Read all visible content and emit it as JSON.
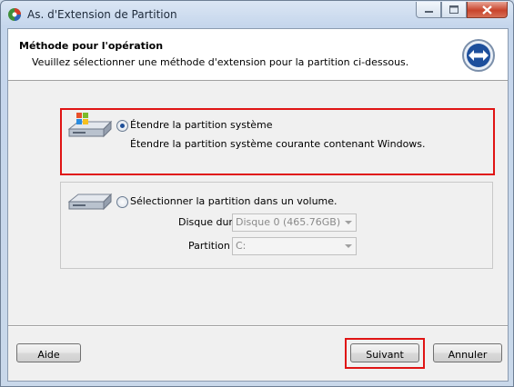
{
  "window": {
    "title": "As. d'Extension de Partition",
    "controls": [
      "minimize-icon",
      "maximize-icon",
      "close-icon"
    ]
  },
  "header": {
    "title": "Méthode pour l'opération",
    "subtitle": "Veuillez sélectionner une méthode d'extension pour la partition ci-dessous.",
    "icon": "double-arrow-icon"
  },
  "options": [
    {
      "label": "Étendre la partition système",
      "description": "Étendre la partition système courante contenant Windows.",
      "selected": true,
      "icon": "system-disk-icon"
    },
    {
      "label": "Sélectionner la partition dans un volume.",
      "selected": false,
      "icon": "disk-icon",
      "fields": {
        "disk_label": "Disque dur",
        "disk_value": "Disque 0 (465.76GB)",
        "partition_label": "Partition",
        "partition_value": "C:"
      }
    }
  ],
  "buttons": {
    "help": "Aide",
    "next": "Suivant",
    "cancel": "Annuler"
  },
  "colors": {
    "highlight": "#e01414",
    "radio_selected": "#1f4f98"
  }
}
